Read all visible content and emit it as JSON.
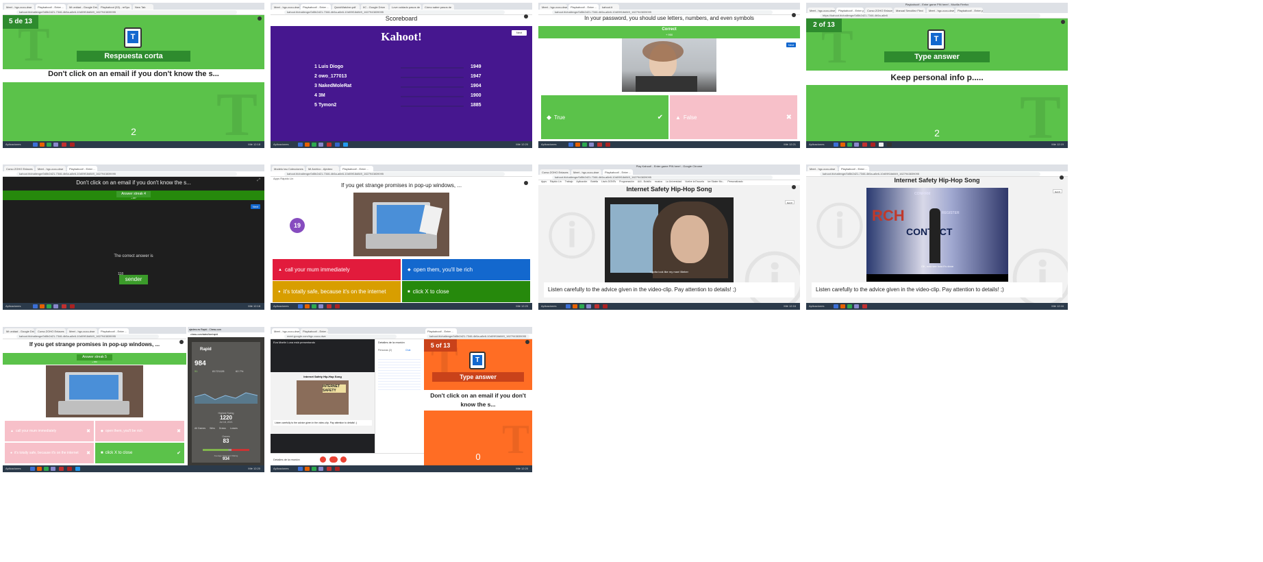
{
  "tiles": {
    "t1": {
      "tabs": [
        "Meet - hgc-cucu-dwe",
        "Playkahoot! - Enter ...",
        "Mi unidad - Google Driv",
        "Playkahoot (53) - reSpo",
        "New Tab"
      ],
      "url": "kahoot.it/challenge/0d5b2d21-7346-4b5a-a8e6-10d09f18d849_1627943839095",
      "progress": "5 de 13",
      "badge": "Respuesta corta",
      "question": "Don't click on an email if you don't know the s...",
      "count": "2",
      "taskbar_label": "Aplicaciones",
      "time": "Mié 12:18"
    },
    "t2": {
      "tabs": [
        "Meet - hgc-cucu-dwe",
        "Playkahoot! - Enter ...",
        "QuickWatcher.pdf",
        "IIC - Google Drive",
        "Love cuidado pasos de",
        "Cómo saber pasos de"
      ],
      "url": "kahoot.it/challenge/0d5b2d21-7346-4b5a-a8e6-10d09f18d849_1627943839095",
      "header": "Scoreboard",
      "logo": "Kahoot!",
      "next": "Next",
      "rows": [
        {
          "rank": "1",
          "name": "Luis Diogo",
          "score": "1949"
        },
        {
          "rank": "2",
          "name": "owo_177013",
          "score": "1947"
        },
        {
          "rank": "3",
          "name": "NakedMoleRat",
          "score": "1904"
        },
        {
          "rank": "4",
          "name": "3M",
          "score": "1900"
        },
        {
          "rank": "5",
          "name": "Tymon2",
          "score": "1885"
        }
      ],
      "taskbar_label": "Aplicaciones",
      "time": "Mié 12:20"
    },
    "t3": {
      "tabs": [
        "Meet - hgc-cucu-dwe",
        "Playkahoot! - Enter ...",
        "kahoot.it"
      ],
      "url": "kahoot.it/challenge/0d5b2d21-7346-4b5a-a8e6-10d09f18d849_1627943839095",
      "question": "In your password, you should use letters, numbers, and even symbols",
      "correct": "Correct",
      "correct_sub": "+ 950",
      "next": "Next",
      "true_label": "True",
      "false_label": "False",
      "taskbar_label": "Aplicaciones",
      "time": "Mié 12:21"
    },
    "t4": {
      "window_title": "Playkahoot! - Enter game PIN here! - Mozilla Firefox",
      "tabs": [
        "Meet - hgc-cucu-dwe",
        "Playkahoot! - Enter p...",
        "Curso ZOHO Enlaces",
        "Manual Sencillez Flexi",
        "Meet - hgc-cucu-dwe",
        "Playkahoot! - Enter p..."
      ],
      "url": "https://kahoot.it/challenge/0d5b2d21-7346-4b5a-a8e6",
      "progress": "2 of 13",
      "badge": "Type answer",
      "question": "Keep personal info p.....",
      "count": "2",
      "taskbar_label": "Aplicaciones",
      "time": "Mié 12:19"
    },
    "t5": {
      "tabs": [
        "Curso ZOHO Enlaces",
        "Meet - hgc-cucu-dwe",
        "Playkahoot! - Enter ..."
      ],
      "url": "kahoot.it/challenge/0d5b2d21-7346-4b5a-a8e6-10d09f18d849_1627943839095",
      "question": "Don't click on an email if you don't know the s...",
      "streak": "Answer streak 4",
      "streak_sub": "+ 257",
      "next": "Next",
      "answer_is": "The correct answer is",
      "answer_count": "118",
      "answer": "sender",
      "taskbar_label": "Aplicaciones",
      "time": "Mié 12:18"
    },
    "t6": {
      "tabs": [
        "Modelo tau Colecciones",
        "Mi Archivo - Ajedrez",
        "Playkahoot! - Enter ..."
      ],
      "url": "kahoot.it/challenge/0d5b2d21-7346-4b5a-a8e6-10d09f18d849_1627943839095",
      "bookmarks": "Apps   Rápido Lin",
      "question": "If you get strange promises in pop-up windows, ...",
      "timer": "19",
      "answers": [
        "call your mum immediately",
        "open them, you'll be rich",
        "it's totally safe, because it's on the internet",
        "click X to close"
      ],
      "taskbar_label": "Aplicaciones",
      "time": "Mié 12:20"
    },
    "t7": {
      "window_title": "Play Kahoot! - Enter game PIN here! - Google Chrome",
      "tabs": [
        "Curso ZOHO Enlaces",
        "Meet - hgc-cucu-dwe",
        "Playkahoot! - Enter ..."
      ],
      "url": "kahoot.it/challenge/0d5b2d21-7346-4b5a-a8e6-10d09f18d849_1627943839095",
      "bookmarks": [
        "Apps",
        "Rápido Lin",
        "Trabajo",
        "Aplicación",
        "Botella",
        "Lisa's DONTs",
        "Programación",
        "AAI - Bolsillo",
        "musica",
        "La Universidad",
        "Vuelve la Escuela",
        "Ice Skater Mo...",
        "Personalizado"
      ],
      "title": "Internet Safety Hip-Hop Song",
      "skip": "Got it!",
      "subtitle_on_video": "I gotta look like my man! Bieber",
      "caption": "Listen carefully to the advice given in the video-clip. Pay attention to details! ;)",
      "taskbar_label": "Aplicaciones",
      "time": "Mié 12:16"
    },
    "t8": {
      "tabs": [
        "Meet - hgc-cucu-dwe",
        "Playkahoot! - Enter ..."
      ],
      "url": "kahoot.it/challenge/0d5b2d21-7346-4b5a-a8e6-10d09f18d849_1627943839095",
      "title": "Internet Safety Hip-Hop Song",
      "skip": "Got it!",
      "video_word": "CONTACT",
      "video_word2": "CONFIRM",
      "video_word3": "REGISTER",
      "subtitle_on_video": "OK, now see how it's done",
      "caption": "Listen carefully to the advice given in the video-clip. Pay attention to details! ;)",
      "taskbar_label": "Aplicaciones",
      "time": "Mié 12:16"
    },
    "t9": {
      "tabs": [
        "Mi unidad - Google Drive",
        "Curso ZOHO Enlaces",
        "Meet - hgc-cucu-dwe",
        "Playkahoot! - Enter ..."
      ],
      "url": "kahoot.it/challenge/0d5b2d21-7346-4b5a-a8e6-10d09f18d849_1627943839095",
      "question": "If you get strange promises in pop-up windows, ...",
      "streak": "Answer streak 5",
      "streak_sub": "+ 950",
      "answers": [
        "call your mum immediately",
        "open them, you'll be rich",
        "it's totally safe, because it's on the internet",
        "click X to close"
      ],
      "side_tab": "ajedrez.es Rapid - Chess.com",
      "side_url": "chess.com/stats/live/rapid",
      "side_mode": "Rapid",
      "side_rating": "984",
      "side_w": "91",
      "side_d": "81721128",
      "side_pct": "62.7%",
      "side_high": "1220",
      "side_high_label": "Highest Rating",
      "side_high_date": "Jul 18, 2021",
      "side_tabs": [
        "All Games",
        "Wins",
        "Draws",
        "Losses"
      ],
      "side_games": "83",
      "side_games_label": "Games",
      "side_footer": "Average Opponent Rating",
      "side_footer_val": "934",
      "taskbar_label": "Aplicaciones",
      "time": "Mié 12:20"
    },
    "t10": {
      "tabs": [
        "Meet - hgc-cucu-dwe",
        "Playkahoot! - Enter ..."
      ],
      "url": "meet.google.com/hgc-cucu-dwe",
      "presenting": "Eva Martin Luna está presentando",
      "details": "Detalles de la reunión",
      "people": "Personas (2)",
      "chat": "Chat",
      "meet_title": "Internet Safety Hip-Hop Song",
      "meet_caption": "Listen carefully to the advice given in the video-clip. Pay attention to details! ;)",
      "poster": "INTERNET SAFETY",
      "footer": "Detalles de la reunión",
      "k_progress": "5 of 13",
      "k_tabs": [
        "Playkahoot! - Enter ..."
      ],
      "k_url": "kahoot.it/challenge/0d5b2d21-7346-4b5a-a8e6-10d09f18d849_1627943839095",
      "k_badge": "Type answer",
      "k_question": "Don't click on an email if you don't know the s...",
      "k_count": "0",
      "taskbar_label": "Aplicaciones",
      "time": "Mié 12:20"
    }
  },
  "colors": {
    "kahoot_green": "#5bc24a",
    "kahoot_purple": "#46178f",
    "kahoot_red": "#e21b3c",
    "kahoot_blue": "#1368ce",
    "kahoot_gold": "#d89e00",
    "kahoot_dgreen": "#26890c",
    "kahoot_orange": "#ff6d24",
    "taskbar": "#2b3a4a"
  }
}
